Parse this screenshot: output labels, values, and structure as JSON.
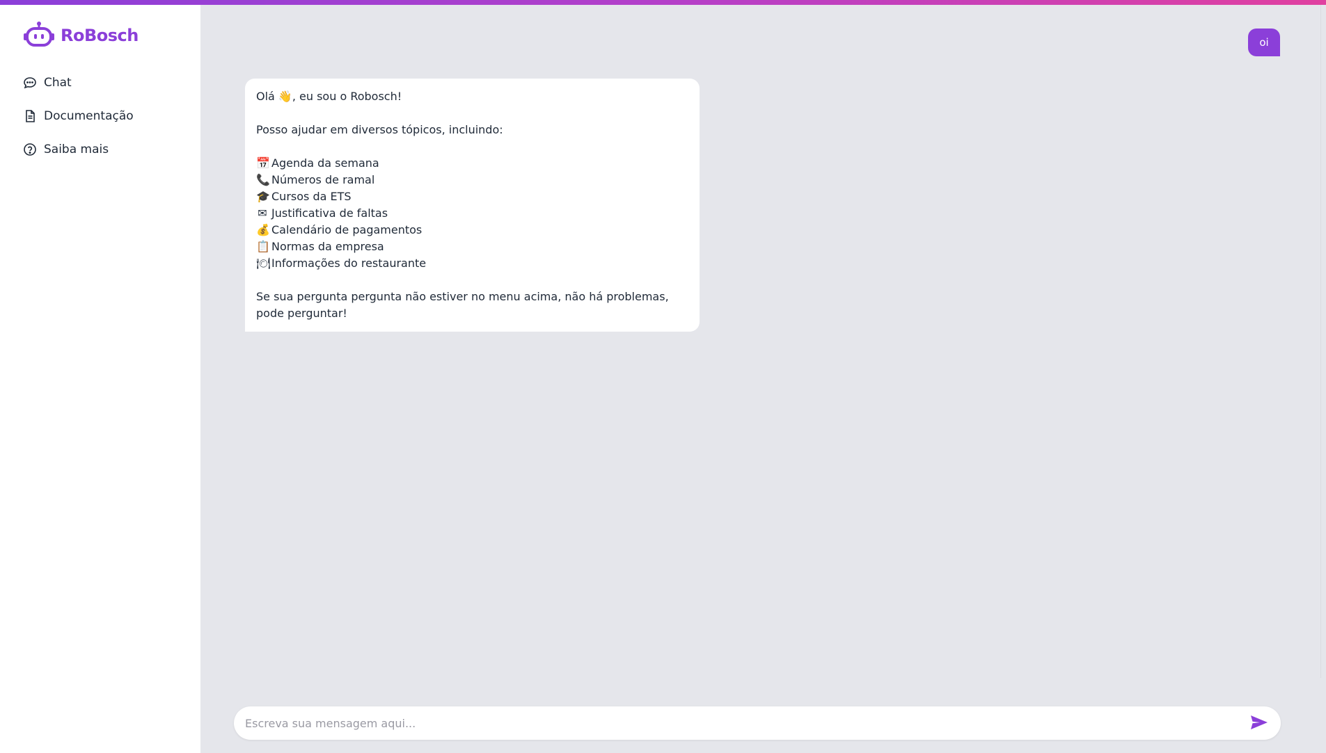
{
  "app": {
    "name": "RoBosch",
    "accent_color": "#8b3fd9",
    "logo_icon": "robot-icon"
  },
  "sidebar": {
    "items": [
      {
        "label": "Chat",
        "icon": "chat-bubble-icon"
      },
      {
        "label": "Documentação",
        "icon": "document-icon"
      },
      {
        "label": "Saiba mais",
        "icon": "help-circle-icon"
      }
    ]
  },
  "conversation": {
    "user_message": "oi",
    "bot_message": {
      "greeting": "Olá 👋, eu sou o Robosch!",
      "intro": "Posso ajudar em diversos tópicos, incluindo:",
      "topics": [
        {
          "emoji": "📅",
          "label": "Agenda da semana"
        },
        {
          "emoji": "📞",
          "label": "Números de ramal"
        },
        {
          "emoji": "🎓",
          "label": "Cursos da ETS"
        },
        {
          "emoji": "✉",
          "label": "Justificativa de faltas"
        },
        {
          "emoji": "💰",
          "label": "Calendário de pagamentos"
        },
        {
          "emoji": "📋",
          "label": "Normas da empresa"
        },
        {
          "emoji": "🍽",
          "label": "Informações do restaurante"
        }
      ],
      "closing_line1": "Se sua pergunta pergunta não estiver no menu acima, não há problemas,",
      "closing_line2": "pode perguntar!"
    }
  },
  "composer": {
    "placeholder": "Escreva sua mensagem aqui...",
    "value": "",
    "send_icon": "send-icon"
  }
}
